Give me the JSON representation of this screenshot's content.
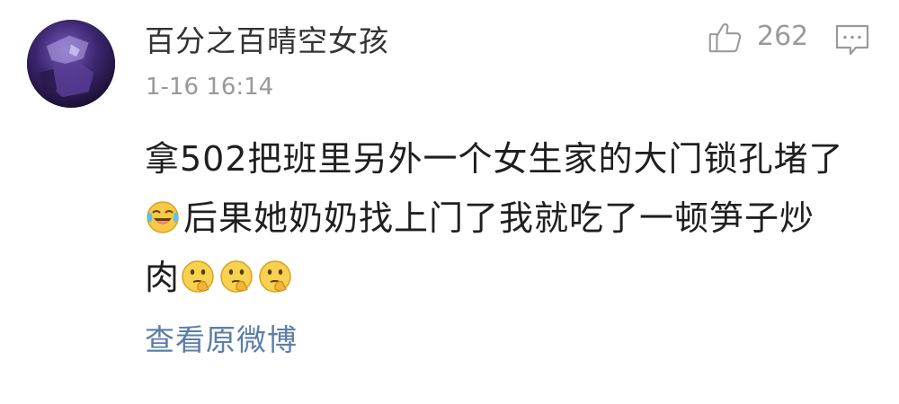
{
  "comment": {
    "username": "百分之百晴空女孩",
    "timestamp": "1-16 16:14",
    "like_count": "262",
    "text": {
      "line1": "拿502把班里另外一个女生家的大门锁孔堵了",
      "line2": "后果她奶奶找上门了我就吃了一顿笋子炒",
      "line3": "肉"
    },
    "emojis": {
      "line2_start": "laugh-cry-emoji",
      "line3_end": [
        "thinking-emoji",
        "thinking-emoji",
        "thinking-emoji"
      ]
    },
    "view_original_label": "查看原微博"
  },
  "colors": {
    "username": "#333333",
    "timestamp": "#999999",
    "link": "#5b7da8",
    "icon": "#9a9a9a"
  }
}
